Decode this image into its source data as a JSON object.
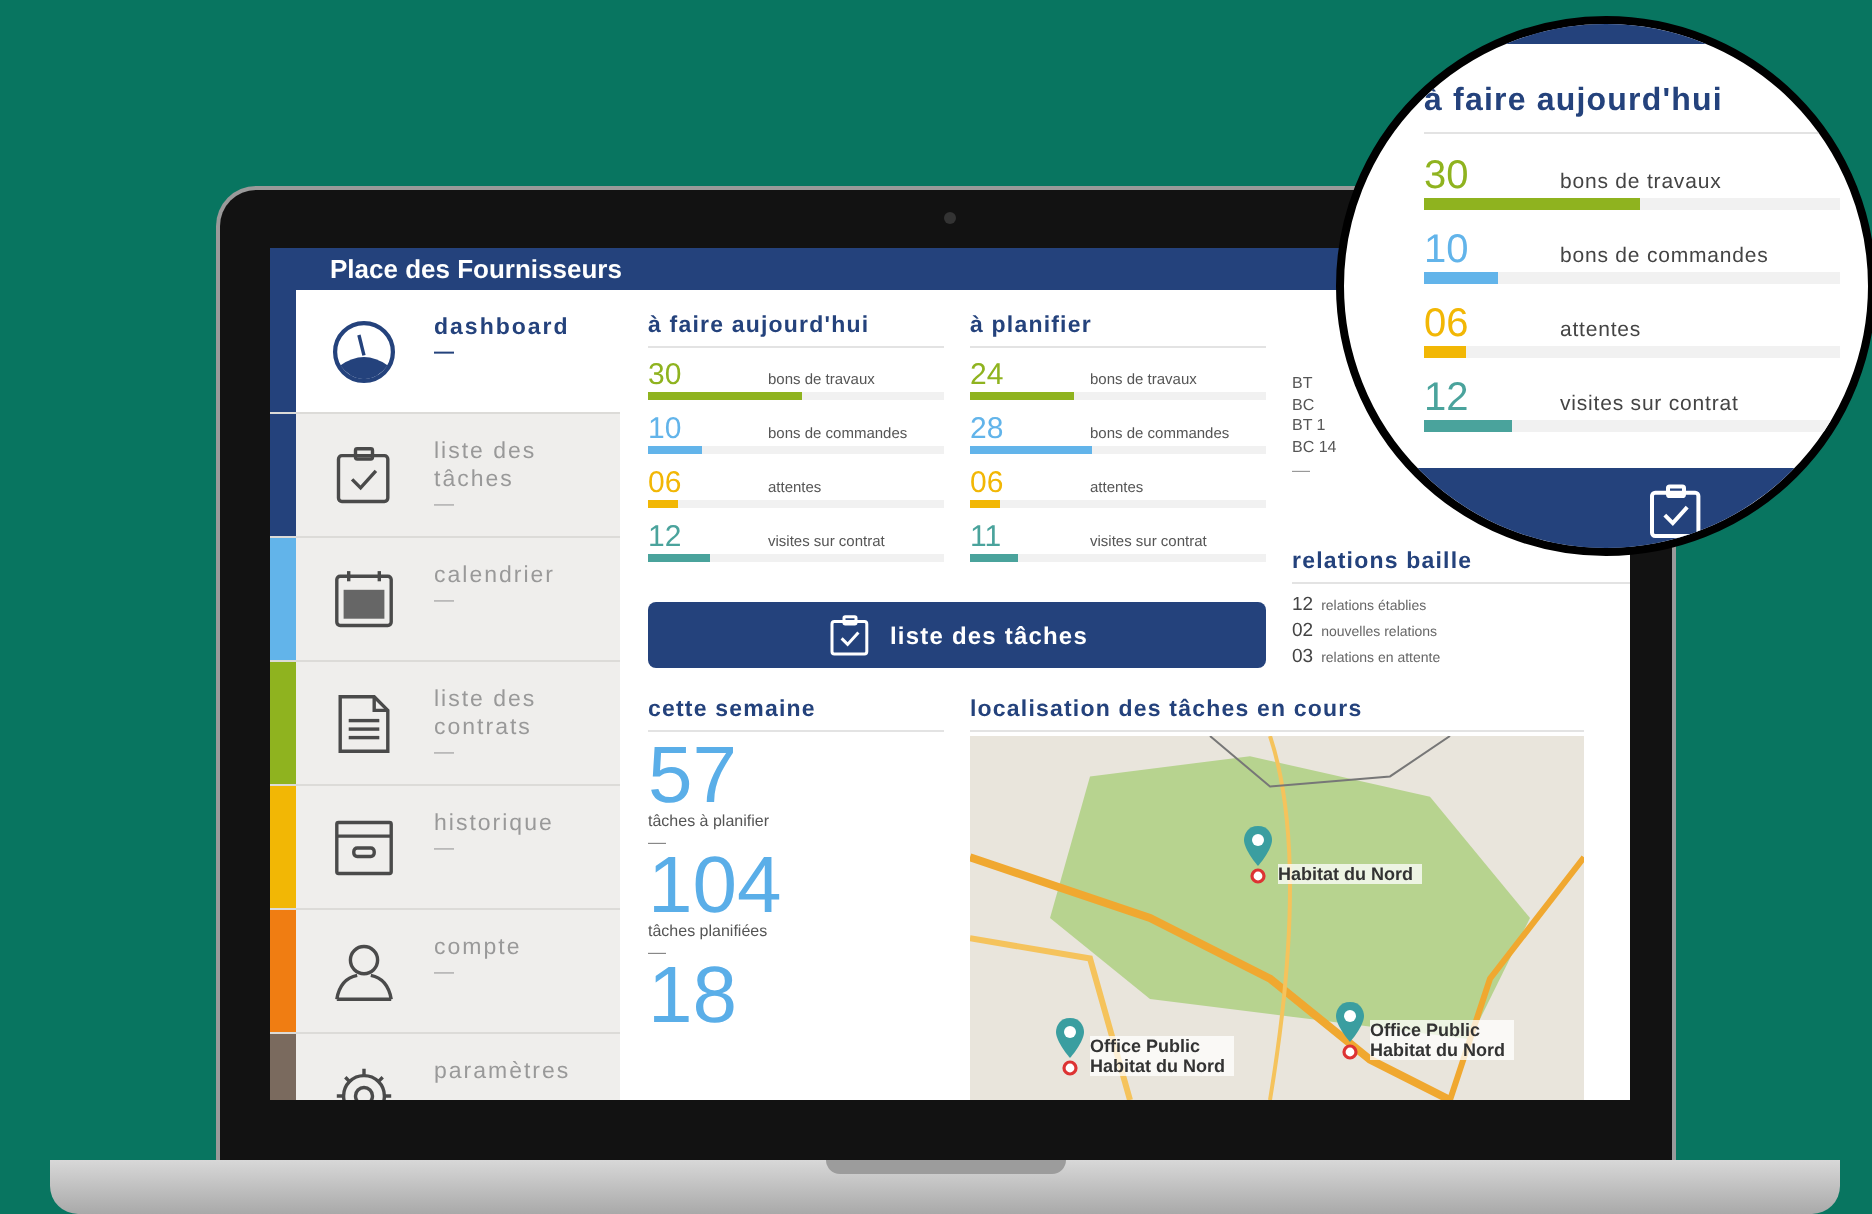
{
  "app": {
    "title": "Place des Fournisseurs"
  },
  "sidebar": {
    "items": [
      {
        "label": "dashboard",
        "dash": "—",
        "color": "#24427c",
        "selected": true
      },
      {
        "label": "liste des tâches",
        "dash": "—",
        "color": "#24427c",
        "selected": false
      },
      {
        "label": "calendrier",
        "dash": "—",
        "color": "#62b4ea",
        "selected": false
      },
      {
        "label": "liste des contrats",
        "dash": "—",
        "color": "#8fb31f",
        "selected": false
      },
      {
        "label": "historique",
        "dash": "—",
        "color": "#f2b705",
        "selected": false
      },
      {
        "label": "compte",
        "dash": "—",
        "color": "#f07d12",
        "selected": false
      },
      {
        "label": "paramètres",
        "color": "#7a6a5e",
        "selected": false
      }
    ]
  },
  "today": {
    "heading": "à faire aujourd'hui",
    "rows": [
      {
        "count": "30",
        "label": "bons de travaux",
        "level": 0.52,
        "color": "#8fb31f"
      },
      {
        "count": "10",
        "label": "bons de commandes",
        "level": 0.18,
        "color": "#62b4ea"
      },
      {
        "count": "06",
        "label": "attentes",
        "level": 0.1,
        "color": "#f2b705"
      },
      {
        "count": "12",
        "label": "visites sur contrat",
        "level": 0.21,
        "color": "#4aa39c"
      }
    ]
  },
  "planning": {
    "heading": "à planifier",
    "rows": [
      {
        "count": "24",
        "label": "bons de travaux",
        "level": 0.35,
        "color": "#8fb31f"
      },
      {
        "count": "28",
        "label": "bons de commandes",
        "level": 0.41,
        "color": "#62b4ea"
      },
      {
        "count": "06",
        "label": "attentes",
        "level": 0.1,
        "color": "#f2b705"
      },
      {
        "count": "11",
        "label": "visites sur contrat",
        "level": 0.16,
        "color": "#4aa39c"
      }
    ]
  },
  "third_column": {
    "lines": [
      "BT",
      "BC",
      "BT 1",
      "BC 14"
    ],
    "dash": "—"
  },
  "relations": {
    "heading": "relations baille",
    "rows": [
      {
        "count": "12",
        "label": "relations établies"
      },
      {
        "count": "02",
        "label": "nouvelles relations"
      },
      {
        "count": "03",
        "label": "relations en attente"
      }
    ]
  },
  "task_button": {
    "label": "liste des tâches"
  },
  "week": {
    "heading": "cette semaine",
    "stats": [
      {
        "value": "57",
        "label": "tâches à planifier",
        "dash": "—"
      },
      {
        "value": "104",
        "label": "tâches planifiées",
        "dash": "—"
      },
      {
        "value": "18"
      }
    ]
  },
  "map": {
    "heading": "localisation des tâches en cours",
    "pins": [
      {
        "label": "Habitat du Nord"
      },
      {
        "label": "Office Public Habitat du Nord"
      },
      {
        "label": "Office Public Habitat du Nord"
      }
    ]
  },
  "magnifier": {
    "heading": "à faire aujourd'hui",
    "rows": [
      {
        "count": "30",
        "label": "bons de travaux",
        "level": 0.52,
        "color": "#8fb31f"
      },
      {
        "count": "10",
        "label": "bons de commandes",
        "level": 0.18,
        "color": "#62b4ea"
      },
      {
        "count": "06",
        "label": "attentes",
        "level": 0.1,
        "color": "#f2b705"
      },
      {
        "count": "12",
        "label": "visites sur contrat",
        "level": 0.21,
        "color": "#4aa39c"
      }
    ]
  }
}
